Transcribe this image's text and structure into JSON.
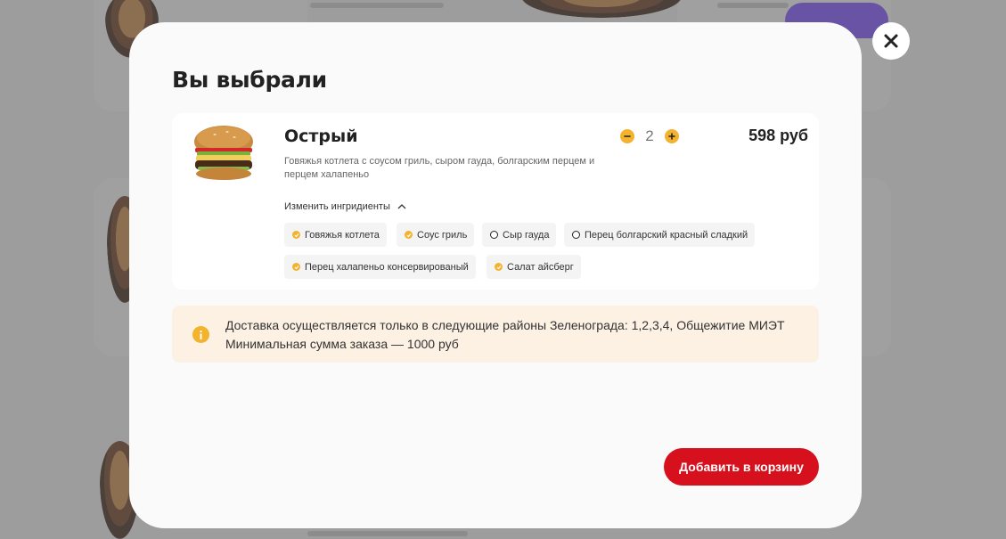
{
  "modal": {
    "title": "Вы выбрали",
    "item": {
      "name": "Острый",
      "description": "Говяжья котлета с соусом гриль, сыром гауда, болгарским перцем и перцем халапеньо",
      "quantity": "2",
      "price": "598 руб",
      "ingredients_toggle": "Изменить ингридиенты",
      "ingredients": [
        {
          "label": "Говяжья котлета",
          "selected": true
        },
        {
          "label": "Соус гриль",
          "selected": true
        },
        {
          "label": "Сыр гауда",
          "selected": false
        },
        {
          "label": "Перец болгарский красный сладкий",
          "selected": false
        },
        {
          "label": "Перец халапеньо консервированый",
          "selected": true
        },
        {
          "label": "Салат айсберг",
          "selected": true
        }
      ]
    },
    "notice": {
      "line1": "Доставка осуществляется только в следующие районы Зеленограда: 1,2,3,4, Общежитие МИЭТ",
      "line2": "Минимальная сумма заказа — 1000 руб"
    },
    "add_button": "Добавить в корзину"
  },
  "colors": {
    "accent": "#f3b32e",
    "primary_button": "#d6101c",
    "notice_bg": "#fcf1e3"
  }
}
